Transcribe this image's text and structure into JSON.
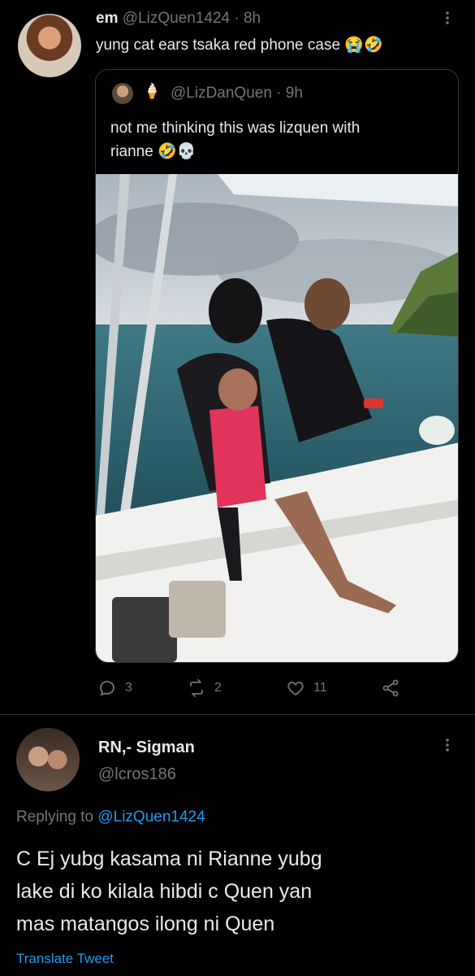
{
  "tweet1": {
    "name": "em",
    "handle": "@LizQuen1424",
    "time": "· 8h",
    "text": "yung cat ears tsaka red phone case",
    "emoji": "😭🤣"
  },
  "quoted": {
    "badge_emoji": "🍦",
    "handle": "@LizDanQuen",
    "time": "· 9h",
    "text_line1": "not me thinking this was lizquen with",
    "text_line2": "rianne",
    "emoji": "🤣💀"
  },
  "actions": {
    "replies": "3",
    "retweets": "2",
    "likes": "11"
  },
  "reply": {
    "name": "RN,- Sigman",
    "handle": "@lcros186",
    "replying_prefix": "Replying to",
    "replying_handle": "@LizQuen1424",
    "text_line1": "C Ej yubg kasama ni Rianne yubg",
    "text_line2": "lake di ko kilala hibdi c Quen yan",
    "text_line3": "mas matangos ilong ni Quen",
    "translate": "Translate Tweet"
  }
}
